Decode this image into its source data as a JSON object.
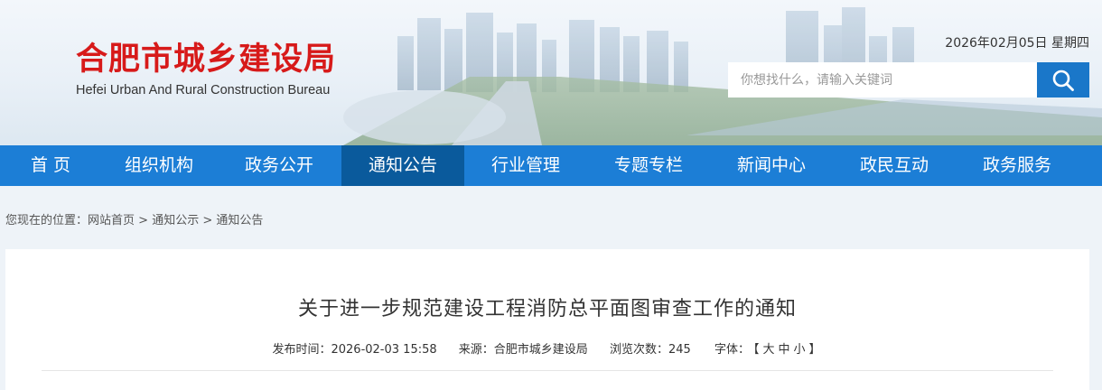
{
  "header": {
    "logo_cn": "合肥市城乡建设局",
    "logo_en": "Hefei Urban And Rural Construction Bureau",
    "date": "2026年02月05日 星期四",
    "search": {
      "placeholder": "你想找什么，请输入关键词",
      "value": ""
    }
  },
  "nav": {
    "items": [
      {
        "label": "首 页"
      },
      {
        "label": "组织机构"
      },
      {
        "label": "政务公开"
      },
      {
        "label": "通知公告",
        "active": true
      },
      {
        "label": "行业管理"
      },
      {
        "label": "专题专栏"
      },
      {
        "label": "新闻中心"
      },
      {
        "label": "政民互动"
      },
      {
        "label": "政务服务"
      }
    ]
  },
  "breadcrumb": {
    "prefix": "您现在的位置：",
    "items": [
      "网站首页",
      "通知公示",
      "通知公告"
    ],
    "separator": " > "
  },
  "article": {
    "title": "关于进一步规范建设工程消防总平面图审查工作的通知",
    "publish_label": "发布时间：",
    "publish_time": "2026-02-03 15:58",
    "source_label": "来源：",
    "source": "合肥市城乡建设局",
    "views_label": "浏览次数：",
    "views": "245",
    "font_label": "字体：",
    "font_open": "【",
    "font_large": "大",
    "font_medium": "中",
    "font_small": "小",
    "font_close": "】"
  },
  "colors": {
    "nav_bg": "#1c7ed6",
    "nav_active": "#0a5a9c",
    "logo_red": "#d71a1a",
    "search_button": "#1a77c9"
  },
  "icons": {
    "search": "search-icon"
  }
}
